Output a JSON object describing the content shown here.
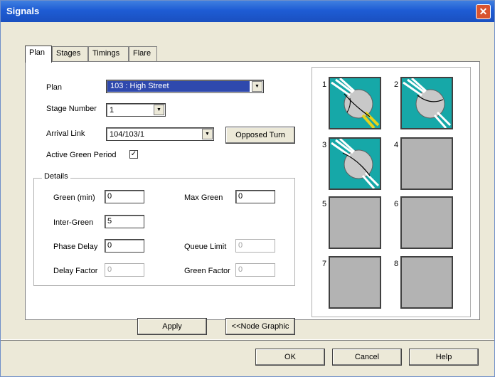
{
  "window": {
    "title": "Signals"
  },
  "tabs": [
    {
      "label": "Plan",
      "active": true
    },
    {
      "label": "Stages",
      "active": false
    },
    {
      "label": "Timings",
      "active": false
    },
    {
      "label": "Flare",
      "active": false
    }
  ],
  "plan": {
    "plan_label": "Plan",
    "plan_value": "103   : High Street",
    "stage_number_label": "Stage Number",
    "stage_number_value": "1",
    "arrival_link_label": "Arrival Link",
    "arrival_link_value": "104/103/1",
    "opposed_turn_label": "Opposed Turn",
    "active_green_label": "Active Green Period",
    "active_green_checked": true,
    "check_mark": "✓"
  },
  "details": {
    "title": "Details",
    "green_min_label": "Green (min)",
    "green_min_value": "0",
    "max_green_label": "Max Green",
    "max_green_value": "0",
    "inter_green_label": "Inter-Green",
    "inter_green_value": "5",
    "phase_delay_label": "Phase Delay",
    "phase_delay_value": "0",
    "queue_limit_label": "Queue Limit",
    "queue_limit_value": "0",
    "delay_factor_label": "Delay Factor",
    "delay_factor_value": "0",
    "green_factor_label": "Green Factor",
    "green_factor_value": "0"
  },
  "buttons": {
    "apply": "Apply",
    "node_graphic": "<<Node Graphic",
    "ok": "OK",
    "cancel": "Cancel",
    "help": "Help"
  },
  "stages": [
    {
      "num": "1",
      "state": "active",
      "highlight": true
    },
    {
      "num": "2",
      "state": "active",
      "highlight": false
    },
    {
      "num": "3",
      "state": "active",
      "highlight": false
    },
    {
      "num": "4",
      "state": "empty"
    },
    {
      "num": "5",
      "state": "empty"
    },
    {
      "num": "6",
      "state": "empty"
    },
    {
      "num": "7",
      "state": "empty"
    },
    {
      "num": "8",
      "state": "empty"
    }
  ],
  "colors": {
    "title_bar": "#1e5cd4",
    "stage_active": "#16a8a8",
    "stage_empty": "#b3b3b3",
    "highlight_arm": "#e8d21a"
  }
}
